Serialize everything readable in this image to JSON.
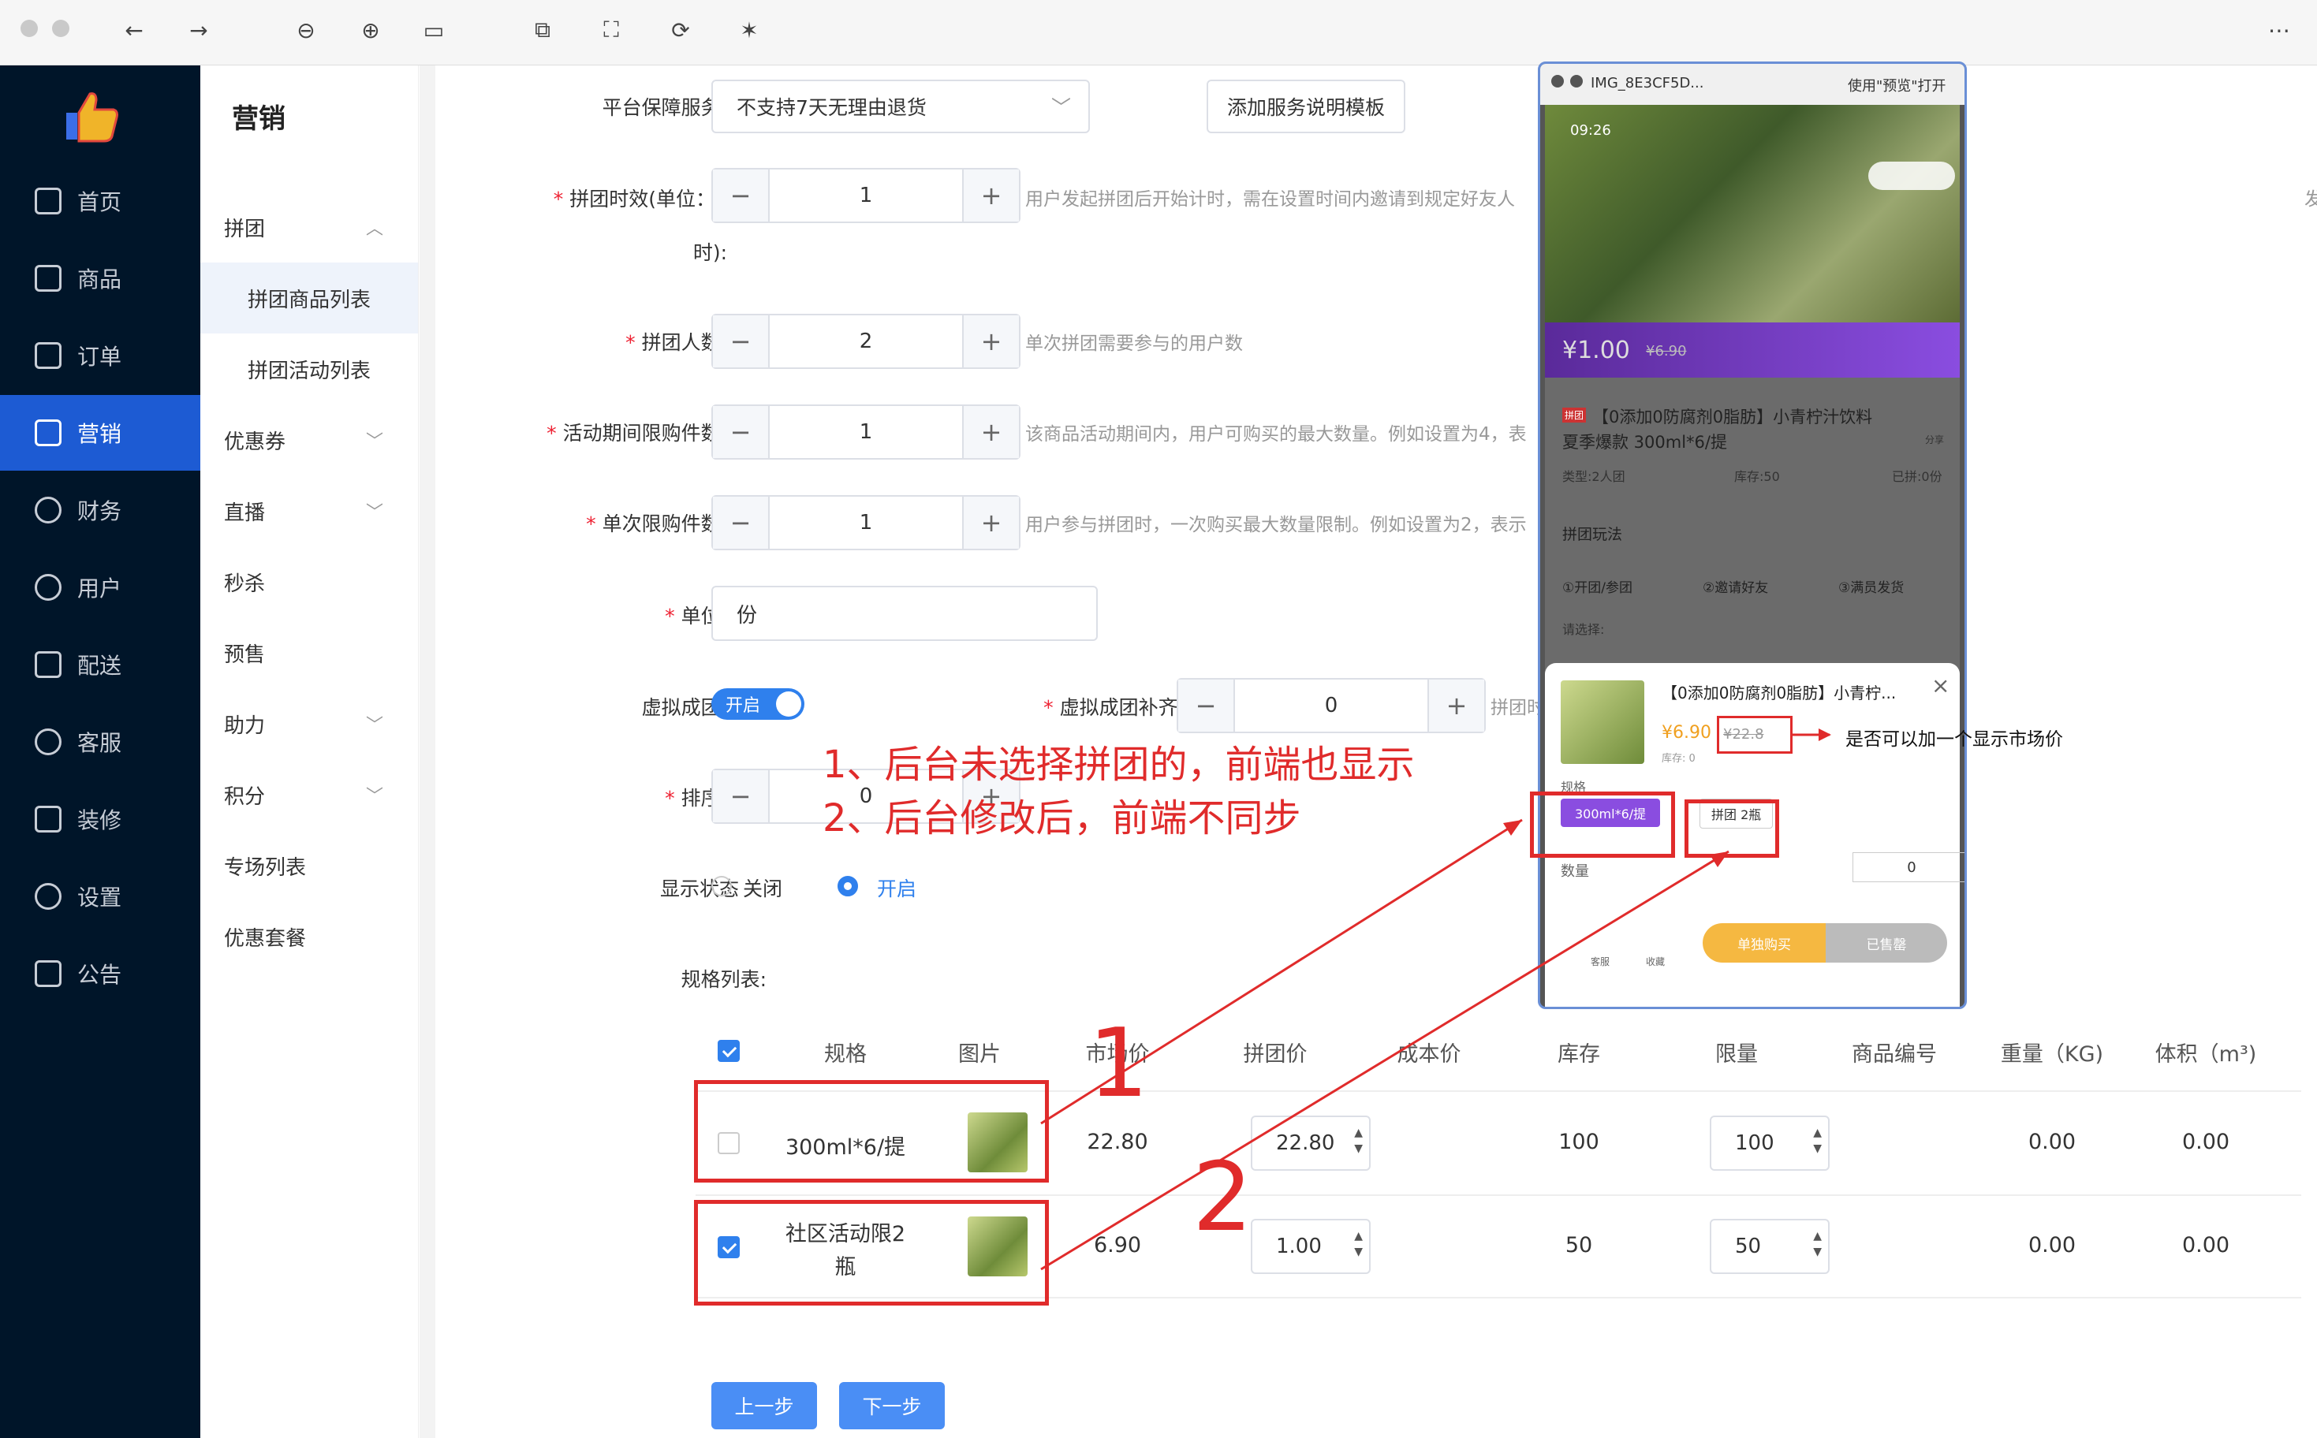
{
  "sidebar": {
    "items": [
      {
        "label": "首页"
      },
      {
        "label": "商品"
      },
      {
        "label": "订单"
      },
      {
        "label": "营销"
      },
      {
        "label": "财务"
      },
      {
        "label": "用户"
      },
      {
        "label": "配送"
      },
      {
        "label": "客服"
      },
      {
        "label": "装修"
      },
      {
        "label": "设置"
      },
      {
        "label": "公告"
      }
    ],
    "active_color": "#1d5bd3"
  },
  "submenu": {
    "title": "营销",
    "items": [
      {
        "label": "拼团"
      },
      {
        "label": "拼团商品列表"
      },
      {
        "label": "拼团活动列表"
      },
      {
        "label": "优惠券"
      },
      {
        "label": "直播"
      },
      {
        "label": "秒杀"
      },
      {
        "label": "预售"
      },
      {
        "label": "助力"
      },
      {
        "label": "积分"
      },
      {
        "label": "专场列表"
      },
      {
        "label": "优惠套餐"
      }
    ]
  },
  "form": {
    "service_label": "平台保障服务:",
    "service_value": "不支持7天无理由退货",
    "service_btn": "添加服务说明模板",
    "duration_label": "拼团时效(单位：小",
    "duration_label2": "时):",
    "duration_value": "1",
    "duration_hint": "用户发起拼团后开始计时，需在设置时间内邀请到规定好友人",
    "duration_hint2": "发起退款",
    "people_label": "拼团人数:",
    "people_value": "2",
    "people_hint": "单次拼团需要参与的用户数",
    "limit_label": "活动期间限购件数:",
    "limit_value": "1",
    "limit_hint": "该商品活动期间内，用户可购买的最大数量。例如设置为4，表",
    "single_label": "单次限购件数:",
    "single_value": "1",
    "single_hint": "用户参与拼团时，一次购买最大数量限制。例如设置为2，表示",
    "unit_label": "单位:",
    "unit_value": "份",
    "virtual_label": "虚拟成团:",
    "virtual_toggle": "开启",
    "virtual_fill_label": "虚拟成团补齐人数:",
    "virtual_fill_value": "0",
    "virtual_fill_hint": "拼团时",
    "sort_label": "排序:",
    "sort_value": "0",
    "status_label": "显示状态",
    "status_off": "关闭",
    "status_on": "开启",
    "spec_label": "规格列表:"
  },
  "table": {
    "headers": [
      "规格",
      "图片",
      "市场价",
      "拼团价",
      "成本价",
      "库存",
      "限量",
      "商品编号",
      "重量（KG)",
      "体积（m³)"
    ],
    "rows": [
      {
        "spec": "300ml*6/提",
        "market": "22.80",
        "group": "22.80",
        "stock": "100",
        "limit": "100",
        "weight": "0.00",
        "volume": "0.00",
        "checked": false
      },
      {
        "spec": "社区活动限2",
        "spec2": "瓶",
        "market": "6.90",
        "group": "1.00",
        "stock": "50",
        "limit": "50",
        "weight": "0.00",
        "volume": "0.00",
        "checked": true
      }
    ]
  },
  "buttons": {
    "prev": "上一步",
    "next": "下一步"
  },
  "annotations": {
    "line1": "1、后台未选择拼团的，前端也显示",
    "line2": "2、后台修改后，前端不同步",
    "n1": "1",
    "n2": "2",
    "market_note": "是否可以加一个显示市场价"
  },
  "phone": {
    "filename": "IMG_8E3CF5D...",
    "open_with": "使用\"预览\"打开",
    "time": "09:26",
    "price": "¥1.00",
    "old_price": "¥6.90",
    "tag": "拼团",
    "product_title": "【0添加0防腐剂0脂肪】小青柠汁饮料",
    "product_title2": "夏季爆款 300ml*6/提",
    "share": "分享",
    "type": "类型:2人团",
    "stock": "库存:50",
    "sold": "已拼:0份",
    "rules": "拼团玩法",
    "step1": "①开团/参团",
    "step2": "②邀请好友",
    "step3": "③满员发货",
    "choose": "请选择:",
    "popup_title": "【0添加0防腐剂0脂肪】小青柠...",
    "popup_price": "¥6.90",
    "popup_old": "¥22.8",
    "popup_stock": "库存: 0",
    "spec_title": "规格",
    "spec1": "300ml*6/提",
    "spec2": "拼团 2瓶",
    "qty_label": "数量",
    "qty": "0",
    "service": "客服",
    "fav": "收藏",
    "buy_single": "单独购买",
    "sold_out": "已售罄"
  }
}
